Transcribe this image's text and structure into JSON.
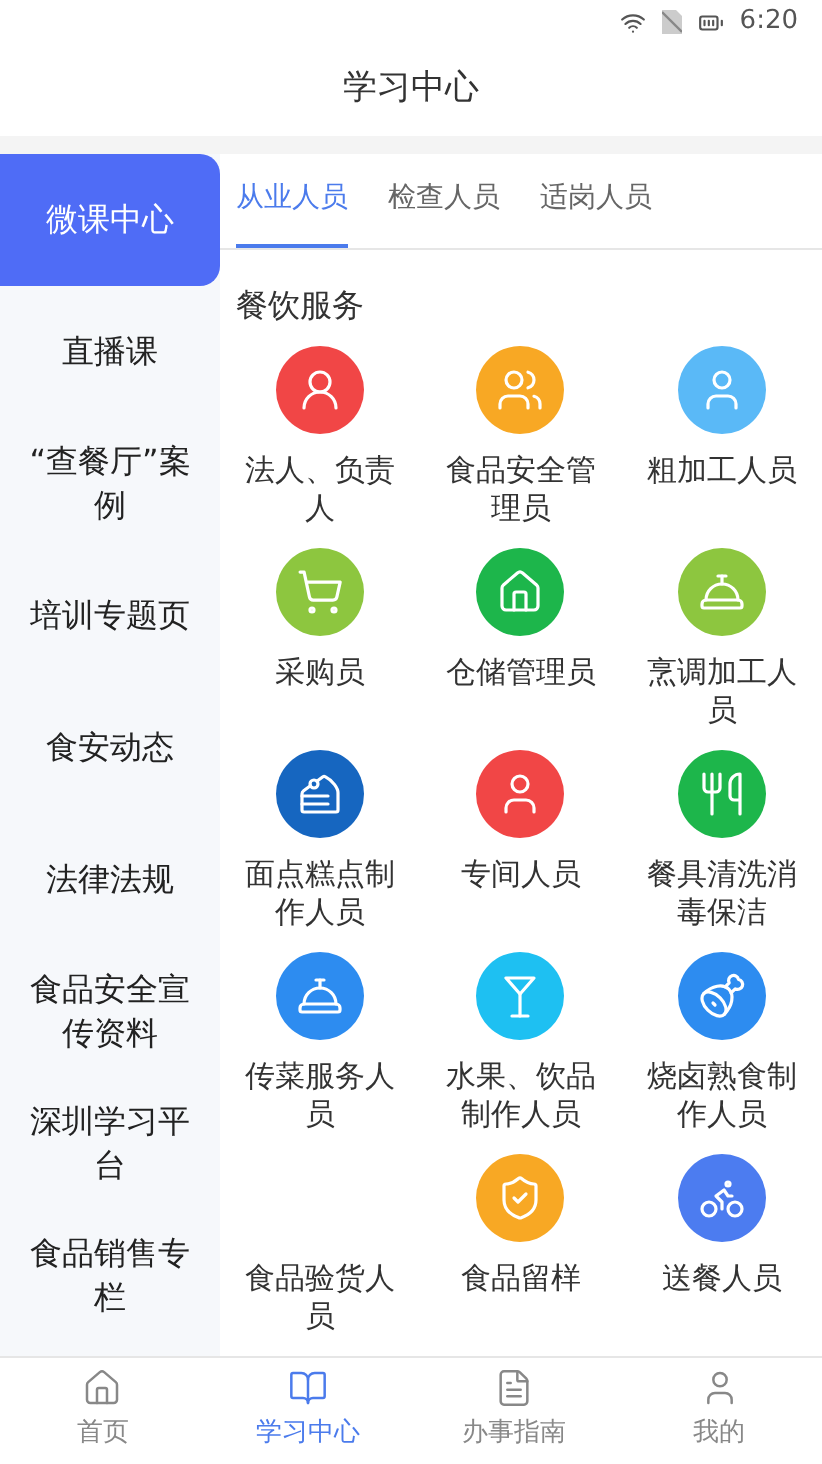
{
  "status_bar": {
    "time": "6:20"
  },
  "header": {
    "title": "学习中心"
  },
  "sidebar": {
    "items": [
      {
        "label": "微课中心",
        "selected": true
      },
      {
        "label": "直播课",
        "selected": false
      },
      {
        "label": "“查餐厅”案例",
        "selected": false
      },
      {
        "label": "培训专题页",
        "selected": false
      },
      {
        "label": "食安动态",
        "selected": false
      },
      {
        "label": "法律法规",
        "selected": false
      },
      {
        "label": "食品安全宣传资料",
        "selected": false
      },
      {
        "label": "深圳学习平台",
        "selected": false
      },
      {
        "label": "食品销售专栏",
        "selected": false
      }
    ]
  },
  "tabs": [
    {
      "label": "从业人员",
      "selected": true
    },
    {
      "label": "检查人员",
      "selected": false
    },
    {
      "label": "适岗人员",
      "selected": false
    }
  ],
  "section": {
    "title": "餐饮服务",
    "items": [
      {
        "label": "法人、负责人",
        "color": "#f14646"
      },
      {
        "label": "食品安全管理员",
        "color": "#f8a824"
      },
      {
        "label": "粗加工人员",
        "color": "#5ab9f7"
      },
      {
        "label": "采购员",
        "color": "#8dc63f"
      },
      {
        "label": "仓储管理员",
        "color": "#1db64b"
      },
      {
        "label": "烹调加工人员",
        "color": "#8dc63f"
      },
      {
        "label": "面点糕点制作人员",
        "color": "#1666c0"
      },
      {
        "label": "专间人员",
        "color": "#f14646"
      },
      {
        "label": "餐具清洗消毒保洁",
        "color": "#1db64b"
      },
      {
        "label": "传菜服务人员",
        "color": "#2d8cf0"
      },
      {
        "label": "水果、饮品制作人员",
        "color": "#1ec0f2"
      },
      {
        "label": "烧卤熟食制作人员",
        "color": "#2d8cf0"
      },
      {
        "label": "食品验货人员"
      },
      {
        "label": "食品留样",
        "color": "#f8a824"
      },
      {
        "label": "送餐人员",
        "color": "#4c7cf0"
      }
    ]
  },
  "bottom_nav": [
    {
      "label": "首页",
      "selected": false
    },
    {
      "label": "学习中心",
      "selected": true
    },
    {
      "label": "办事指南",
      "selected": false
    },
    {
      "label": "我的",
      "selected": false
    }
  ]
}
